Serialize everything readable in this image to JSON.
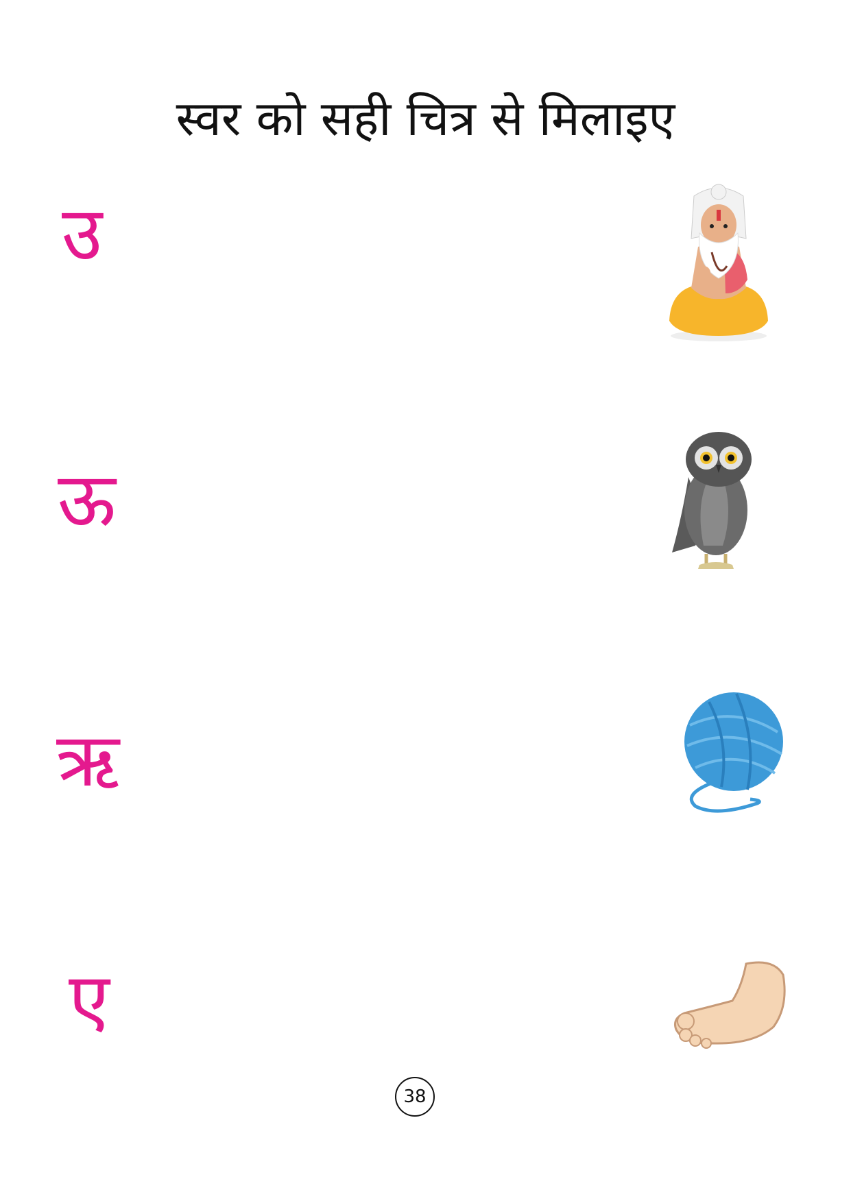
{
  "title": "स्वर को सही चित्र से मिलाइए",
  "vowels": [
    "उ",
    "ऊ",
    "ऋ",
    "ए"
  ],
  "pictures": [
    {
      "icon": "sage-icon"
    },
    {
      "icon": "owl-icon"
    },
    {
      "icon": "yarn-ball-icon"
    },
    {
      "icon": "foot-icon"
    }
  ],
  "page_number": "38",
  "colors": {
    "vowel": "#e4198e",
    "title": "#111111",
    "yarn": "#3d9ad8"
  }
}
